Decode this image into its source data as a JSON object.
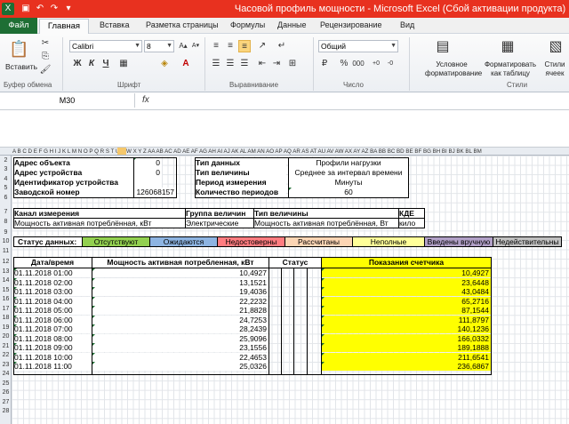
{
  "window": {
    "title": "Часовой профиль мощности - Microsoft Excel (Сбой активации продукта)"
  },
  "tabs": [
    "Файл",
    "Главная",
    "Вставка",
    "Разметка страницы",
    "Формулы",
    "Данные",
    "Рецензирование",
    "Вид"
  ],
  "ribbon": {
    "paste": "Вставить",
    "font_name": "Calibri",
    "font_size": "8",
    "bold": "Ж",
    "italic": "К",
    "underline": "Ч",
    "number_format": "Общий",
    "cond_format": "Условное форматирование",
    "format_table": "Форматировать как таблицу",
    "cell_styles": "Стили ячеек",
    "groups": {
      "clipboard": "Буфер обмена",
      "font": "Шрифт",
      "alignment": "Выравнивание",
      "number": "Число",
      "styles": "Стили"
    }
  },
  "formula_bar": {
    "name_box": "M30",
    "fx": "fx",
    "content": ""
  },
  "columns": "A B C D E F G H I J K L M N O P Q R S T U V W X Y Z AA AB AC AD AE AF AG AH AI AJ AK AL AM AN AO AP AQ AR AS AT AU AV AW AX AY AZ BA BB BC BD BE BF BG BH BI BJ BK BL BM",
  "rows": [
    "2",
    "3",
    "4",
    "5",
    "6",
    "7",
    "8",
    "9",
    "10",
    "11",
    "12",
    "13",
    "14",
    "15",
    "16",
    "17",
    "18",
    "19",
    "20",
    "21",
    "22",
    "23",
    "24",
    "25",
    "26",
    "27",
    "28"
  ],
  "info": {
    "object_address_label": "Адрес объекта",
    "object_address": "0",
    "device_address_label": "Адрес устройства",
    "device_address": "0",
    "device_id_label": "Идентификатор устройства",
    "device_id": "",
    "serial_label": "Заводской номер",
    "serial": "126068157",
    "data_type_label": "Тип данных",
    "data_type": "Профили нагрузки",
    "value_type_label": "Тип величины",
    "value_type": "Среднее за интервал времени",
    "period_label": "Период измерения",
    "period": "Минуты",
    "count_label": "Количество периодов",
    "count": "60"
  },
  "channel": {
    "h_channel": "Канал измерения",
    "h_group": "Группа величин",
    "h_type": "Тип величины",
    "h_kde": "КДЕ",
    "channel": "Мощность активная потреблённая, кВт",
    "group": "Электрические",
    "type": "Мощность активная потреблённая, Вт",
    "kde": "кило"
  },
  "status": {
    "label": "Статус данных:",
    "items": [
      {
        "text": "Отсутствуют",
        "color": "#92d050"
      },
      {
        "text": "Ожидаются",
        "color": "#8db4e2"
      },
      {
        "text": "Недостоверны",
        "color": "#ff7c80"
      },
      {
        "text": "Рассчитаны",
        "color": "#fcd5b4"
      },
      {
        "text": "Неполные",
        "color": "#ffff99"
      },
      {
        "text": "Введены вручную",
        "color": "#b1a0c7"
      },
      {
        "text": "Недействительны",
        "color": "#c0c0c0"
      }
    ]
  },
  "table": {
    "h_datetime": "Дата/время",
    "h_power": "Мощность активная потребленная, кВт",
    "h_status": "Статус",
    "h_meter": "Показания счетчика",
    "meter_color": "#ffff00",
    "rows": [
      {
        "dt": "01.11.2018 01:00",
        "p": "10,4927",
        "m": "10,4927"
      },
      {
        "dt": "01.11.2018 02:00",
        "p": "13,1521",
        "m": "23,6448"
      },
      {
        "dt": "01.11.2018 03:00",
        "p": "19,4036",
        "m": "43,0484"
      },
      {
        "dt": "01.11.2018 04:00",
        "p": "22,2232",
        "m": "65,2716"
      },
      {
        "dt": "01.11.2018 05:00",
        "p": "21,8828",
        "m": "87,1544"
      },
      {
        "dt": "01.11.2018 06:00",
        "p": "24,7253",
        "m": "111,8797"
      },
      {
        "dt": "01.11.2018 07:00",
        "p": "28,2439",
        "m": "140,1236"
      },
      {
        "dt": "01.11.2018 08:00",
        "p": "25,9096",
        "m": "166,0332"
      },
      {
        "dt": "01.11.2018 09:00",
        "p": "23,1556",
        "m": "189,1888"
      },
      {
        "dt": "01.11.2018 10:00",
        "p": "22,4653",
        "m": "211,6541"
      },
      {
        "dt": "01.11.2018 11:00",
        "p": "25,0326",
        "m": "236,6867"
      }
    ]
  }
}
